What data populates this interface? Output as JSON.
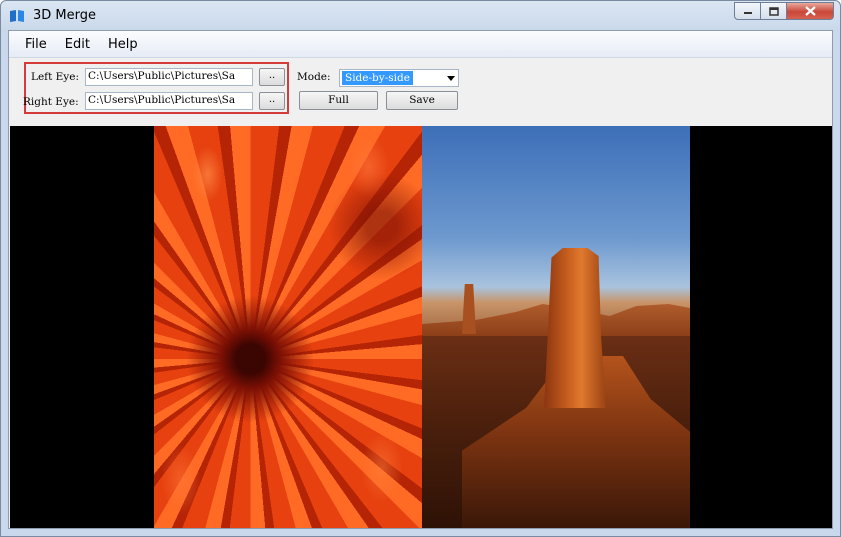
{
  "window": {
    "title": "3D Merge",
    "icon": "book-icon",
    "controls": {
      "minimize": "minimize-icon",
      "maximize": "maximize-icon",
      "close": "close-icon"
    }
  },
  "menu": {
    "items": [
      "File",
      "Edit",
      "Help"
    ]
  },
  "toolbar": {
    "left_eye": {
      "label": "Left Eye:",
      "value": "C:\\Users\\Public\\Pictures\\Sa",
      "browse": ".."
    },
    "right_eye": {
      "label": "Right Eye:",
      "value": "C:\\Users\\Public\\Pictures\\Sa",
      "browse": ".."
    },
    "mode": {
      "label": "Mode:",
      "selected": "Side-by-side"
    },
    "full_button": "Full",
    "save_button": "Save"
  },
  "colors": {
    "highlight_box": "#d53b3b",
    "selection": "#3399ff",
    "preview_background": "#000000"
  }
}
